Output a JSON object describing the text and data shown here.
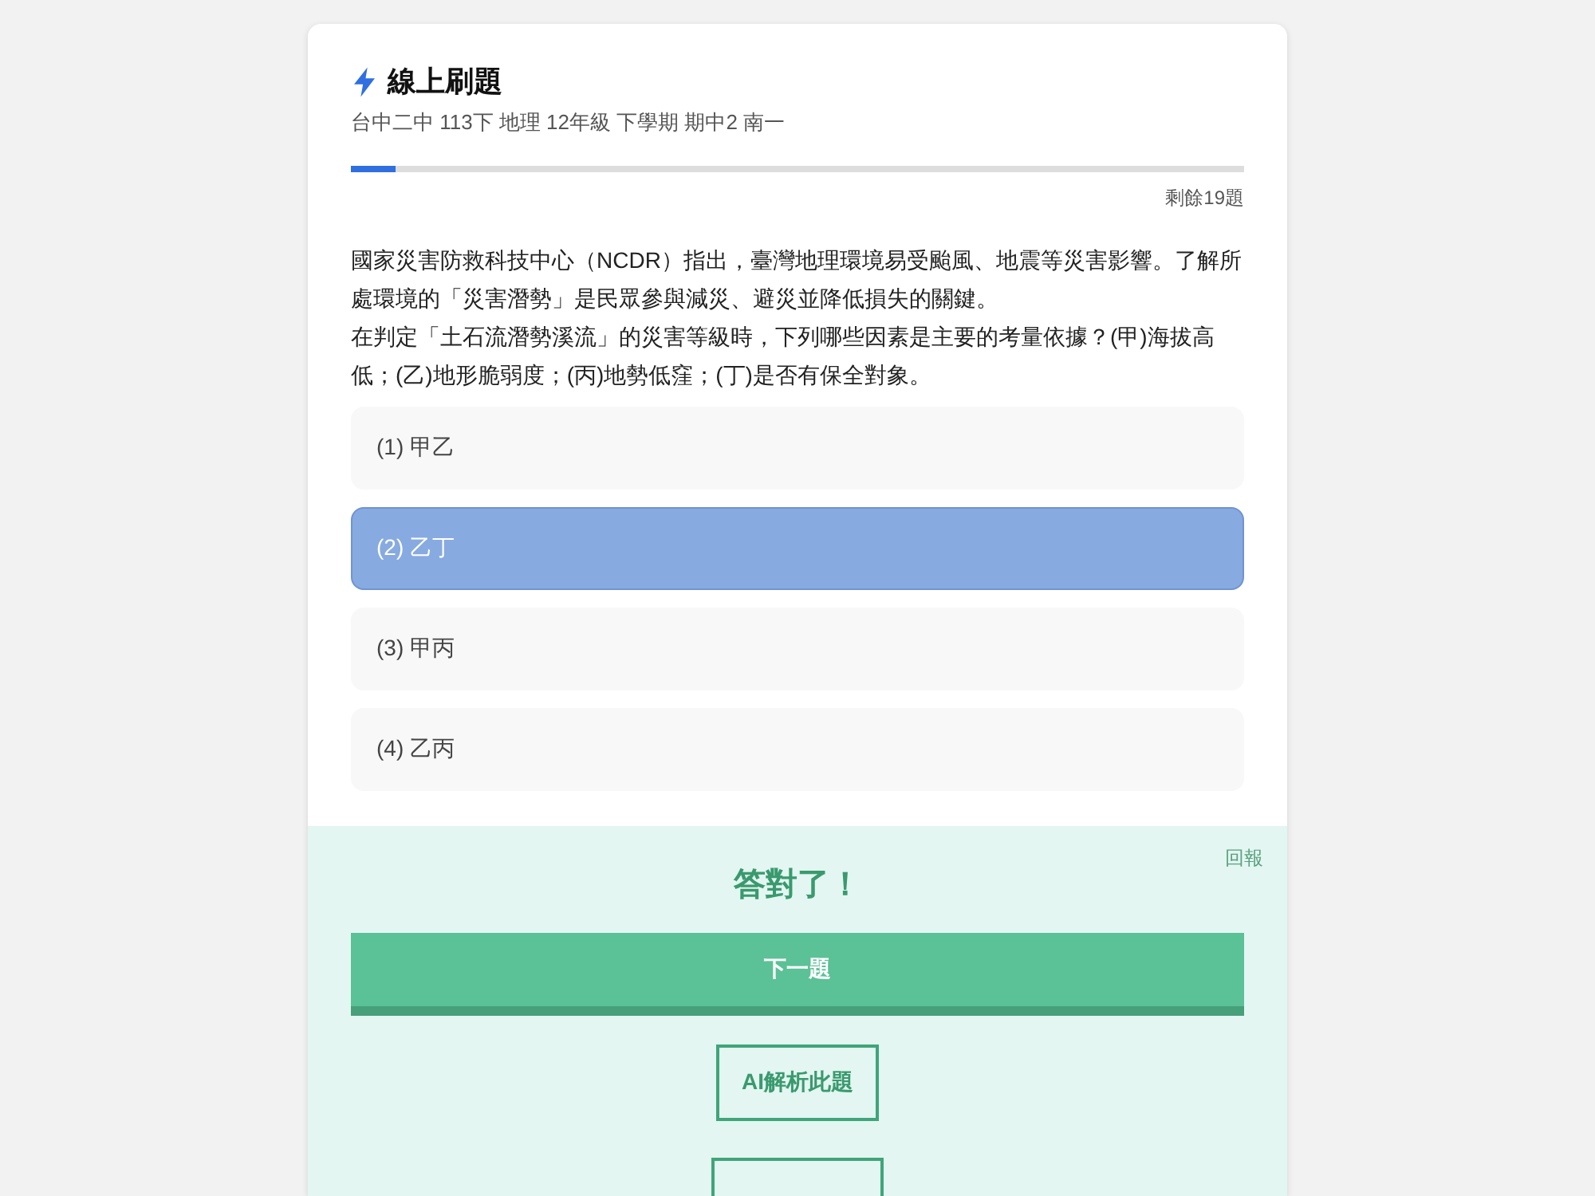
{
  "header": {
    "title": "線上刷題",
    "subtitle": "台中二中 113下 地理 12年級 下學期 期中2 南一"
  },
  "progress": {
    "level": 0.05,
    "remaining": "剩餘19題"
  },
  "question": {
    "paragraphs": [
      "國家災害防救科技中心（NCDR）指出，臺灣地理環境易受颱風、地震等災害影響。了解所處環境的「災害潛勢」是民眾參與減災、避災並降低損失的關鍵。",
      "在判定「土石流潛勢溪流」的災害等級時，下列哪些因素是主要的考量依據？(甲)海拔高低；(乙)地形脆弱度；(丙)地勢低窪；(丁)是否有保全對象。"
    ]
  },
  "options": [
    {
      "label": "(1) 甲乙",
      "selected": false
    },
    {
      "label": "(2) 乙丁",
      "selected": true
    },
    {
      "label": "(3) 甲丙",
      "selected": false
    },
    {
      "label": "(4) 乙丙",
      "selected": false
    }
  ],
  "result": {
    "correct": true,
    "report_link": "回報",
    "message": "答對了！"
  },
  "buttons": [
    {
      "kind": "primary",
      "label": "下一題"
    },
    {
      "kind": "outline",
      "label": "AI解析此題"
    },
    {
      "kind": "cut_off"
    }
  ]
}
